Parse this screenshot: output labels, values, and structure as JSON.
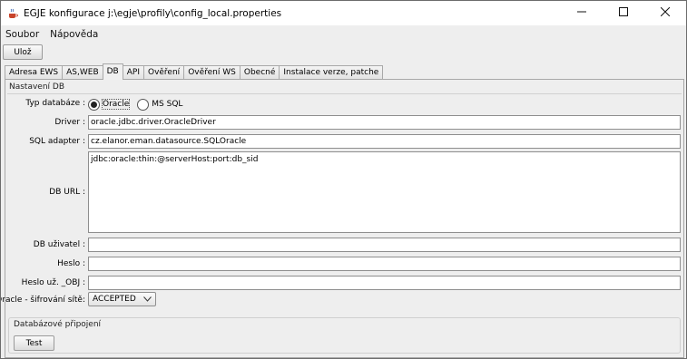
{
  "window": {
    "title": "EGJE konfigurace j:\\egje\\profily\\config_local.properties",
    "controls": {
      "minimize": "—",
      "maximize": "☐",
      "close": "✕"
    }
  },
  "menu": {
    "items": [
      "Soubor",
      "Nápověda"
    ]
  },
  "toolbar": {
    "save_label": "Ulož"
  },
  "tabs": {
    "items": [
      "Adresa EWS",
      "AS,WEB",
      "DB",
      "API",
      "Ověření",
      "Ověření WS",
      "Obecné",
      "Instalace verze, patche"
    ],
    "active": "DB"
  },
  "db": {
    "section_title": "Nastavení DB",
    "type_label": "Typ databáze :",
    "type_options": [
      "Oracle",
      "MS SQL"
    ],
    "type_selected": "Oracle",
    "driver_label": "Driver :",
    "driver_value": "oracle.jdbc.driver.OracleDriver",
    "adapter_label": "SQL adapter :",
    "adapter_value": "cz.elanor.eman.datasource.SQLOracle",
    "url_label": "DB URL :",
    "url_value": "jdbc:oracle:thin:@serverHost:port:db_sid",
    "user_label": "DB uživatel :",
    "user_value": "",
    "password_label": "Heslo :",
    "password_value": "",
    "password_obj_label": "Heslo už. _OBJ :",
    "password_obj_value": "",
    "encryption_label": "Oracle - šifrování sítě:",
    "encryption_value": "ACCEPTED"
  },
  "connection": {
    "group_title": "Databázové připojení",
    "test_label": "Test"
  }
}
